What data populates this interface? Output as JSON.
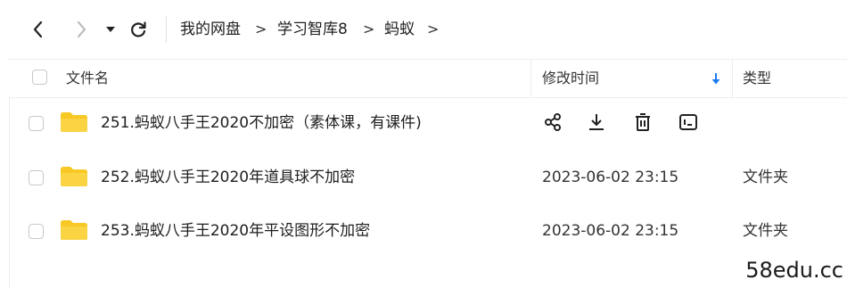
{
  "toolbar": {
    "back_icon": "chevron-left-icon",
    "forward_icon": "chevron-right-icon",
    "history_icon": "caret-down-icon",
    "refresh_icon": "refresh-icon"
  },
  "breadcrumb": {
    "items": [
      "我的网盘",
      "学习智库8",
      "蚂蚁"
    ],
    "separator": ">"
  },
  "table": {
    "columns": {
      "name": "文件名",
      "modified": "修改时间",
      "type": "类型"
    },
    "sort_icon": "sort-arrow-down-icon",
    "sort_color": "#1a7cf0",
    "rows": [
      {
        "name": "251.蚂蚁八手王2020不加密（素体课，有课件)",
        "modified": "",
        "type": "",
        "hovered": true
      },
      {
        "name": "252.蚂蚁八手王2020年道具球不加密",
        "modified": "2023-06-02 23:15",
        "type": "文件夹"
      },
      {
        "name": "253.蚂蚁八手王2020年平设图形不加密",
        "modified": "2023-06-02 23:15",
        "type": "文件夹"
      }
    ],
    "row_actions": [
      "share-icon",
      "download-icon",
      "delete-icon",
      "rename-icon"
    ]
  },
  "folder_color": "#f8c825",
  "watermark": "58edu.cc"
}
